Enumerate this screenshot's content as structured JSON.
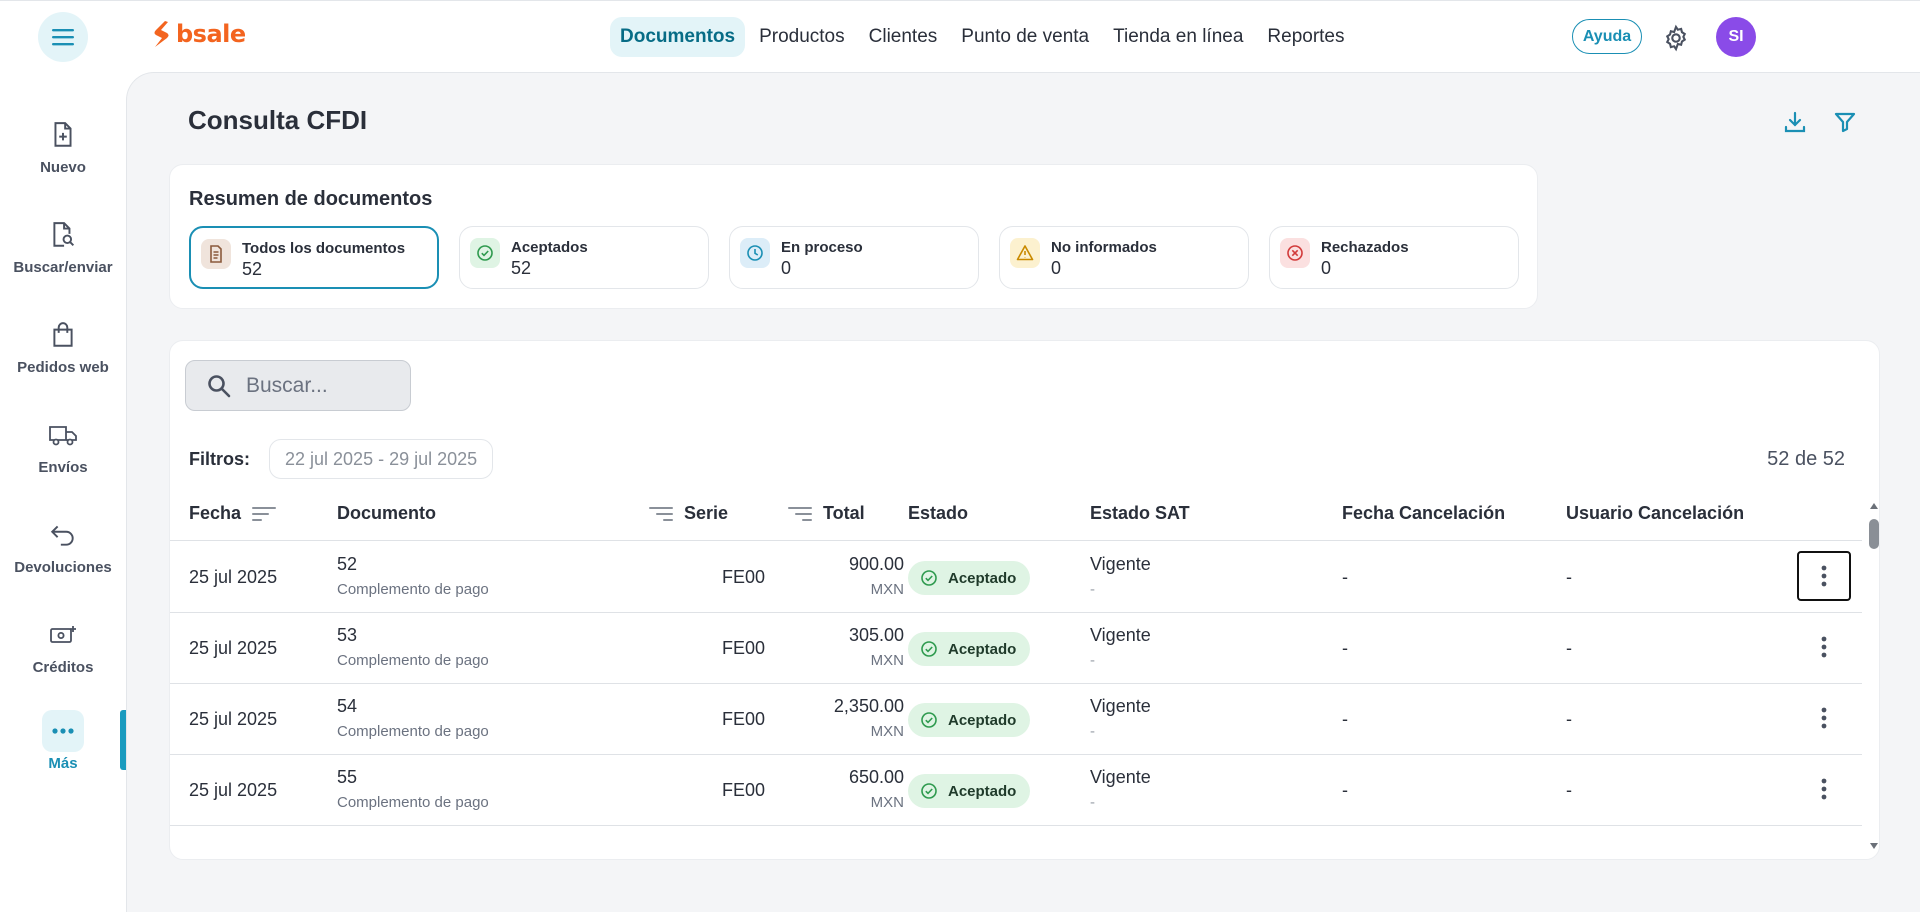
{
  "brand": {
    "name": "bsale",
    "color": "#f3641f"
  },
  "colors": {
    "accent": "#1a8fb4",
    "active_bg": "#e3f4f8",
    "accepted_bg": "#dff4e4",
    "avatar": "#8a4be8"
  },
  "topnav": {
    "tabs": [
      {
        "label": "Documentos",
        "active": true
      },
      {
        "label": "Productos"
      },
      {
        "label": "Clientes"
      },
      {
        "label": "Punto de venta"
      },
      {
        "label": "Tienda en línea"
      },
      {
        "label": "Reportes"
      }
    ],
    "help_label": "Ayuda",
    "avatar_initials": "SI"
  },
  "sidebar": {
    "items": [
      {
        "label": "Nuevo",
        "icon": "file-plus-icon"
      },
      {
        "label": "Buscar/enviar",
        "icon": "file-search-icon"
      },
      {
        "label": "Pedidos web",
        "icon": "bag-icon"
      },
      {
        "label": "Envíos",
        "icon": "truck-icon"
      },
      {
        "label": "Devoluciones",
        "icon": "return-arrow-icon"
      },
      {
        "label": "Créditos",
        "icon": "cash-plus-icon"
      },
      {
        "label": "Más",
        "icon": "more-dots-icon",
        "active": true
      }
    ]
  },
  "page": {
    "title": "Consulta CFDI"
  },
  "summary": {
    "title": "Resumen de documentos",
    "cards": [
      {
        "label": "Todos los documentos",
        "count": "52",
        "icon": "document-icon",
        "active": true
      },
      {
        "label": "Aceptados",
        "count": "52",
        "icon": "check-circle-icon"
      },
      {
        "label": "En proceso",
        "count": "0",
        "icon": "clock-icon"
      },
      {
        "label": "No informados",
        "count": "0",
        "icon": "warning-icon"
      },
      {
        "label": "Rechazados",
        "count": "0",
        "icon": "x-circle-icon"
      }
    ]
  },
  "search": {
    "placeholder": "Buscar..."
  },
  "filters": {
    "label": "Filtros:",
    "date_range": "22 jul 2025 - 29 jul 2025",
    "count": "52 de 52"
  },
  "table": {
    "columns": {
      "fecha": "Fecha",
      "documento": "Documento",
      "serie": "Serie",
      "total": "Total",
      "estado": "Estado",
      "estado_sat": "Estado SAT",
      "fecha_cancelacion": "Fecha Cancelación",
      "usuario_cancelacion": "Usuario Cancelación"
    },
    "rows": [
      {
        "fecha": "25 jul 2025",
        "numero": "52",
        "tipo": "Complemento de pago",
        "serie": "FE00",
        "total": "900.00",
        "moneda": "MXN",
        "estado": "Aceptado",
        "estado_sat": "Vigente",
        "estado_sat_sub": "-",
        "fecha_cancelacion": "-",
        "usuario_cancelacion": "-"
      },
      {
        "fecha": "25 jul 2025",
        "numero": "53",
        "tipo": "Complemento de pago",
        "serie": "FE00",
        "total": "305.00",
        "moneda": "MXN",
        "estado": "Aceptado",
        "estado_sat": "Vigente",
        "estado_sat_sub": "-",
        "fecha_cancelacion": "-",
        "usuario_cancelacion": "-"
      },
      {
        "fecha": "25 jul 2025",
        "numero": "54",
        "tipo": "Complemento de pago",
        "serie": "FE00",
        "total": "2,350.00",
        "moneda": "MXN",
        "estado": "Aceptado",
        "estado_sat": "Vigente",
        "estado_sat_sub": "-",
        "fecha_cancelacion": "-",
        "usuario_cancelacion": "-"
      },
      {
        "fecha": "25 jul 2025",
        "numero": "55",
        "tipo": "Complemento de pago",
        "serie": "FE00",
        "total": "650.00",
        "moneda": "MXN",
        "estado": "Aceptado",
        "estado_sat": "Vigente",
        "estado_sat_sub": "-",
        "fecha_cancelacion": "-",
        "usuario_cancelacion": "-"
      }
    ]
  }
}
